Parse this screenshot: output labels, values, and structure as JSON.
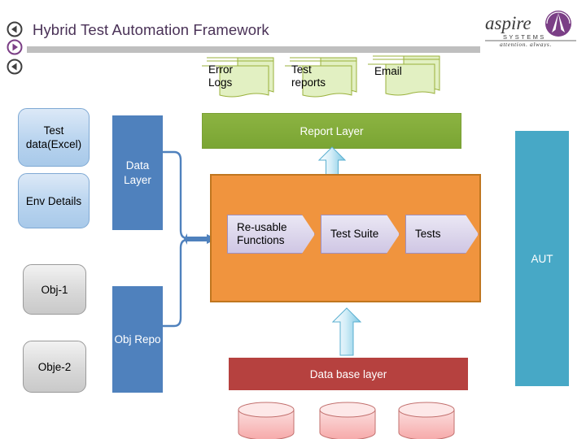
{
  "header": {
    "title": "Hybrid Test Automation Framework",
    "rule_color": "#bfbfbf",
    "title_color": "#4a3257",
    "nav_icons": [
      {
        "name": "back-circle-icon",
        "direction": "back",
        "color": "#3f3f3f"
      },
      {
        "name": "forward-circle-icon",
        "direction": "forward",
        "color": "#7b3f86"
      },
      {
        "name": "back-circle-icon-2",
        "direction": "back",
        "color": "#3f3f3f"
      }
    ]
  },
  "logo": {
    "wordmark": "aspire",
    "subtitle": "S Y S T E M S",
    "tagline": "attention. always.",
    "mark_color": "#7b3f86",
    "text_color": "#3b3b3b"
  },
  "outputs": [
    {
      "id": "error-logs",
      "label": "Error\nLogs",
      "line1": "Error",
      "line2": "Logs"
    },
    {
      "id": "test-reports",
      "label": "Test\nreports",
      "line1": "Test",
      "line2": "reports"
    },
    {
      "id": "email",
      "label": "Email",
      "line1": "Email",
      "line2": ""
    }
  ],
  "layers": {
    "report": {
      "label": "Report Layer",
      "color": "#8cb342"
    },
    "database": {
      "label": "Data base layer",
      "color": "#b6413f"
    }
  },
  "inputs": [
    {
      "id": "test-data",
      "label": "Test data(Excel)",
      "style": "blue"
    },
    {
      "id": "env-details",
      "label": "Env Details",
      "style": "blue"
    },
    {
      "id": "obj-1",
      "label": "Obj-1",
      "style": "gray"
    },
    {
      "id": "obje-2",
      "label": "Obje-2",
      "style": "gray"
    }
  ],
  "pillars": {
    "data_layer": {
      "label": "Data Layer",
      "color": "#4f81bd"
    },
    "obj_repo": {
      "label": "Obj Repo",
      "color": "#4f81bd"
    },
    "aut": {
      "label": "AUT",
      "color": "#47a8c6"
    }
  },
  "engine": {
    "panel_color": "#f0943e",
    "steps": [
      {
        "id": "reusable-functions",
        "label": "Re-usable Functions",
        "line1": "Re-usable",
        "line2": "Functions"
      },
      {
        "id": "test-suite",
        "label": "Test Suite",
        "line1": "Test Suite",
        "line2": ""
      },
      {
        "id": "tests",
        "label": "Tests",
        "line1": "Tests",
        "line2": ""
      }
    ]
  },
  "databases": [
    {
      "id": "db-1",
      "color": "#f6b6b6"
    },
    {
      "id": "db-2",
      "color": "#f6b6b6"
    },
    {
      "id": "db-3",
      "color": "#f6b6b6"
    }
  ],
  "arrows": {
    "report_arrow_color": "#a8dcf0",
    "database_arrow_color": "#a8dcf0",
    "connector_color": "#4f81bd"
  }
}
